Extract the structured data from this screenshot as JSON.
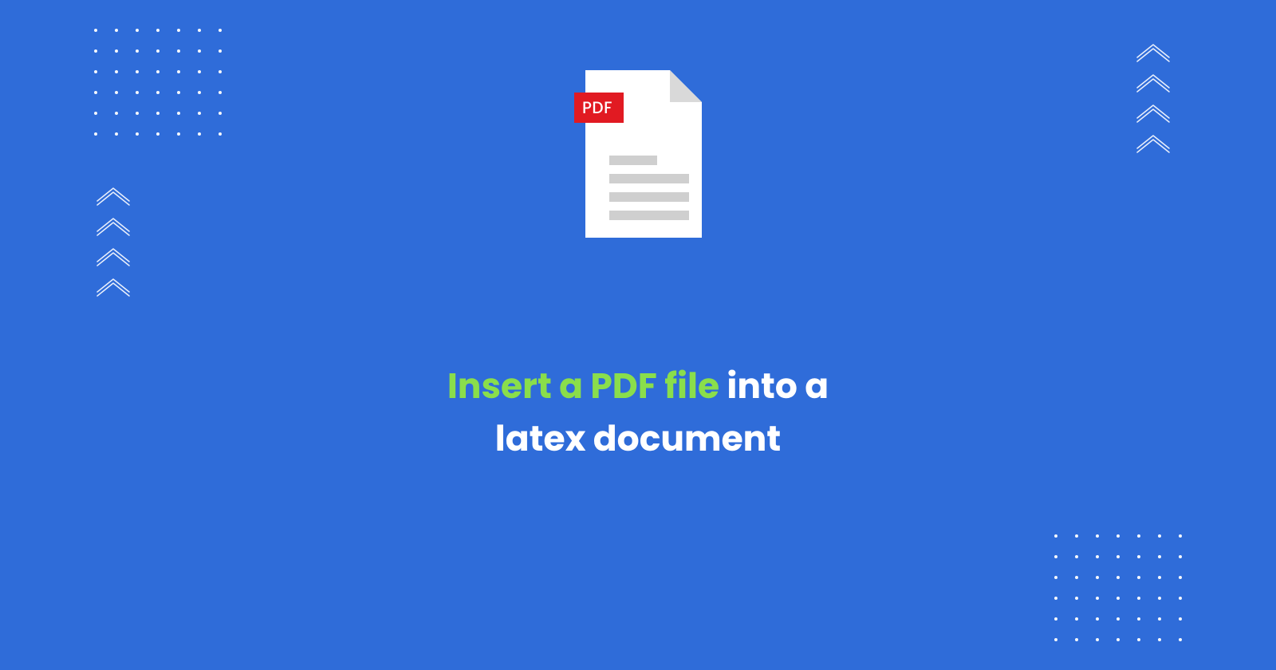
{
  "pdf_badge": "PDF",
  "headline": {
    "accent": "Insert a PDF file",
    "rest_line1": " into a",
    "line2": "latex document"
  },
  "colors": {
    "background": "#2F6CD9",
    "accent_text": "#8ADE4B",
    "pdf_badge": "#E11A22"
  }
}
